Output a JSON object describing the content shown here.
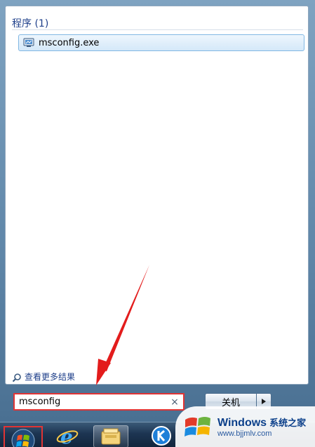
{
  "results": {
    "section_title": "程序 (1)",
    "items": [
      {
        "label": "msconfig.exe",
        "icon": "system-config-icon"
      }
    ]
  },
  "see_more": {
    "label": "查看更多结果",
    "icon": "search-icon"
  },
  "search": {
    "value": "msconfig",
    "clear_icon": "×"
  },
  "shutdown": {
    "label": "关机",
    "arrow_icon": "triangle-right-icon"
  },
  "taskbar": {
    "items": [
      "start-orb-icon",
      "internet-explorer-icon",
      "file-explorer-icon",
      "k-app-icon"
    ]
  },
  "watermark": {
    "brand": "Windows",
    "brand_cn": "系统之家",
    "url": "www.bjjmlv.com"
  },
  "colors": {
    "highlight_red": "#e13434",
    "title_blue": "#1e3f8a",
    "taskbar": "#1d3552"
  }
}
